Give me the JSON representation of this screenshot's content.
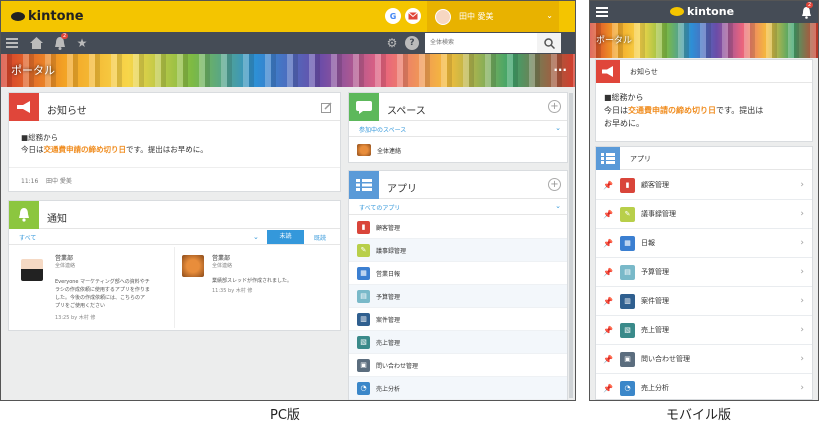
{
  "pc": {
    "brand": "kintone",
    "user": "田中 愛美",
    "g_badge": "G",
    "search_placeholder": "全体検索",
    "bell_count": "2",
    "banner_title": "ポータル",
    "banner_more": "...",
    "notice": {
      "title": "お知らせ",
      "line1": "■総務から",
      "line2_pre": "今日は",
      "line2_highlight": "交通費申請の締め切り日",
      "line2_post": "です。提出はお早めに。",
      "time": "11:16",
      "author": "田中 愛美"
    },
    "notifications": {
      "title": "通知",
      "filter": "すべて",
      "tab_unread": "未読",
      "tab_read": "既読",
      "items": [
        {
          "space": "営業部",
          "channel": "全体連絡",
          "body1": "Everyone マーケティング部への資料やチ",
          "body2": "ラシの作成依頼に使用するアプリを作りま",
          "body3": "した。今後の作成依頼には、こちらのア",
          "body4": "プリをご使用ください",
          "time": "13:25",
          "by": "by 木村 修"
        },
        {
          "space": "営業部",
          "channel": "全体連絡",
          "body1": "業績部スレッドが作成されました。",
          "body2": "",
          "body3": "",
          "body4": "",
          "time": "11:35",
          "by": "by 木村 修"
        }
      ]
    },
    "spaces": {
      "title": "スペース",
      "filter": "参加中のスペース",
      "items": [
        "全体連絡"
      ]
    },
    "apps": {
      "title": "アプリ",
      "filter": "すべてのアプリ",
      "items": [
        "顧客管理",
        "議事録管理",
        "営業日報",
        "予算管理",
        "案件管理",
        "売上管理",
        "問い合わせ管理",
        "売上分析"
      ]
    }
  },
  "mobile": {
    "brand": "kintone",
    "bell_count": "2",
    "banner_title": "ポータル",
    "notice": {
      "title": "お知らせ",
      "line1": "■総務から",
      "line2_pre": "今日は",
      "line2_highlight": "交通費申請の締め切り日",
      "line2_post": "です。提出は",
      "line3": "お早めに。"
    },
    "apps": {
      "title": "アプリ",
      "items": [
        "顧客管理",
        "議事録管理",
        "日報",
        "予算管理",
        "案件管理",
        "売上管理",
        "問い合わせ管理",
        "売上分析"
      ]
    }
  },
  "captions": {
    "pc": "PC版",
    "mobile": "モバイル版"
  },
  "colors": {
    "brand_yellow": "#f4c500",
    "nav_dark": "#454c56",
    "link_blue": "#3498db",
    "highlight_orange": "#f08c1e",
    "notice_red": "#e0463a",
    "notify_green": "#8cc63f",
    "space_green": "#5db85b",
    "app_blue": "#5a9ad8"
  },
  "icons": {
    "menu": "hamburger-icon",
    "home": "home-icon",
    "bell": "bell-icon",
    "star": "star-icon",
    "gear": "gear-icon",
    "help": "help-icon",
    "search": "search-icon",
    "edit": "edit-icon",
    "pin": "pin-icon"
  }
}
